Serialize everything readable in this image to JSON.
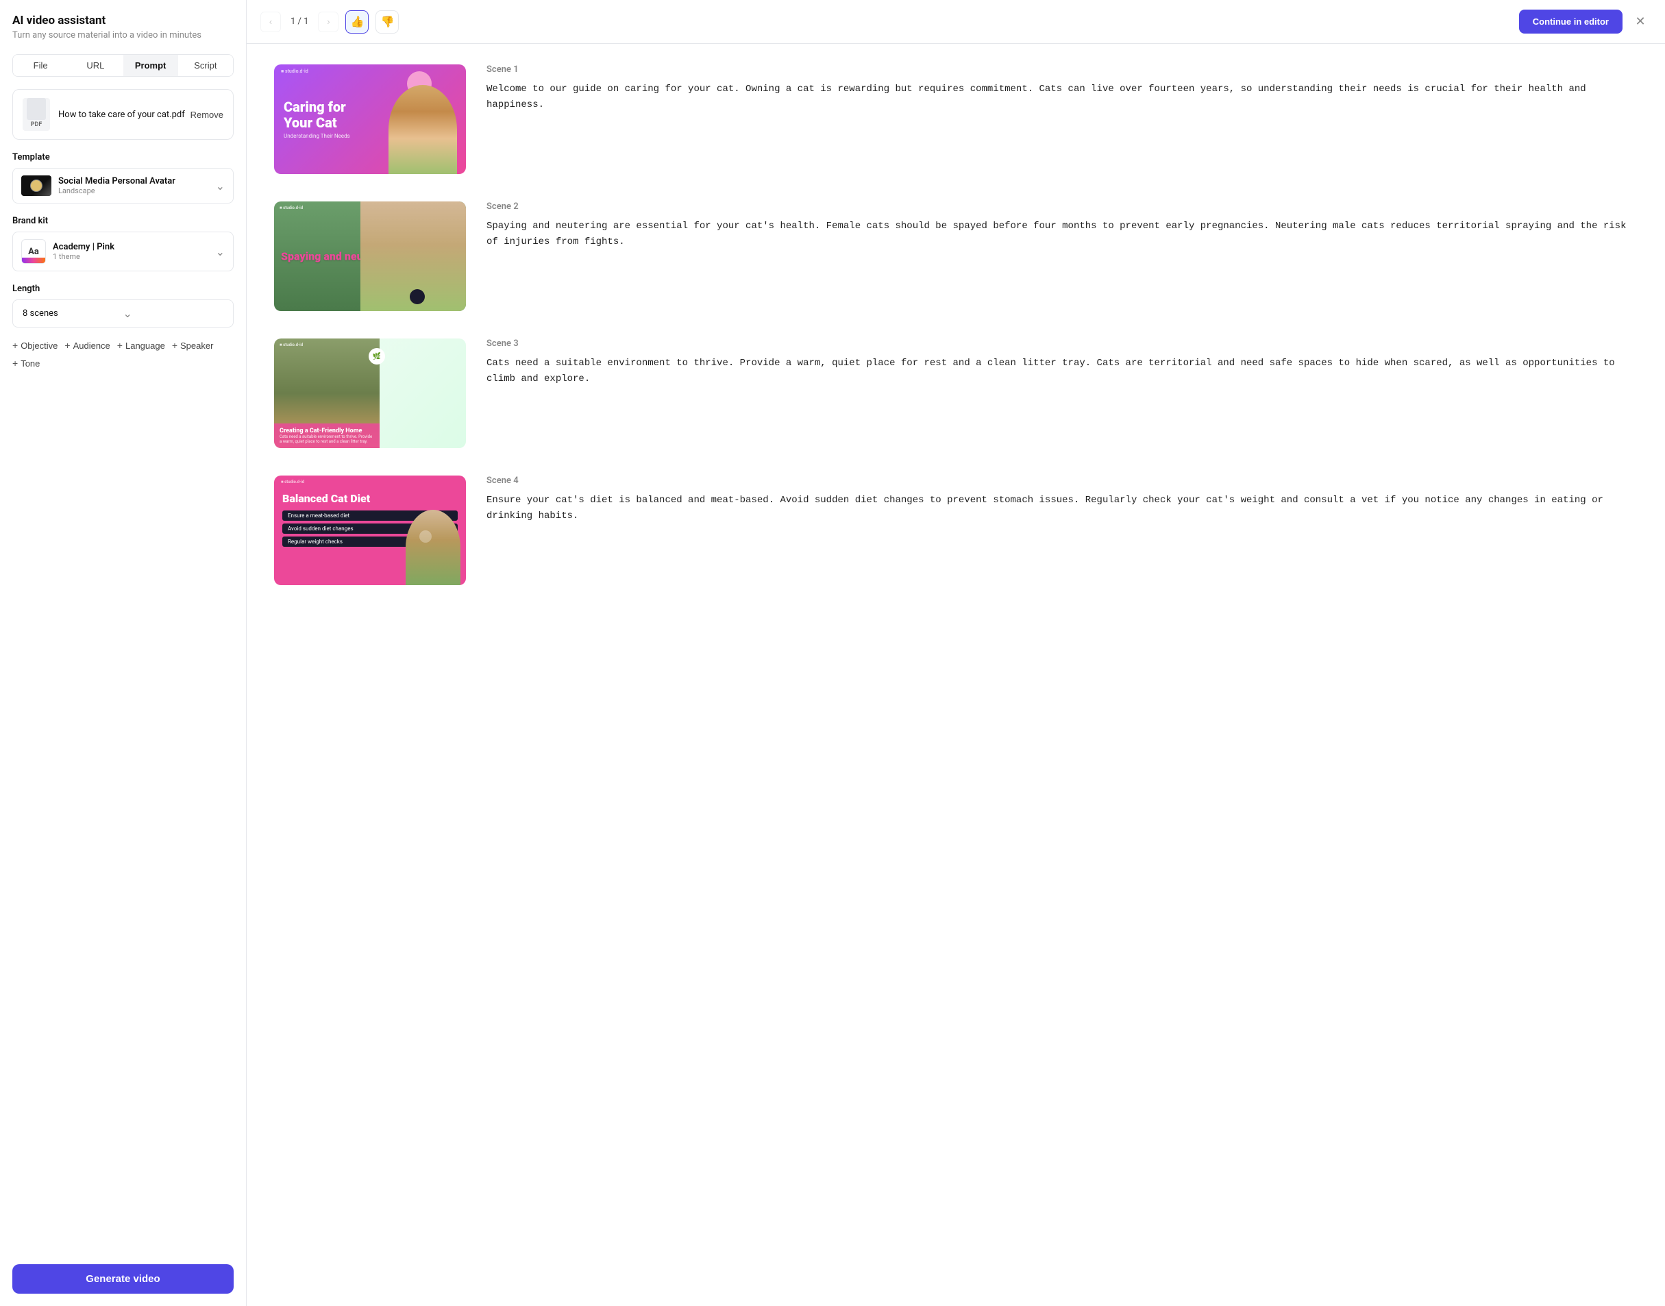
{
  "sidebar": {
    "title": "AI video assistant",
    "subtitle": "Turn any source material into a video in minutes",
    "tabs": [
      {
        "id": "file",
        "label": "File",
        "active": false
      },
      {
        "id": "url",
        "label": "URL",
        "active": false
      },
      {
        "id": "prompt",
        "label": "Prompt",
        "active": true
      },
      {
        "id": "script",
        "label": "Script",
        "active": false
      }
    ],
    "file": {
      "name": "How to take care of your cat.pdf",
      "type": "PDF",
      "remove_label": "Remove"
    },
    "template": {
      "label": "Template",
      "name": "Social Media Personal Avatar",
      "orientation": "Landscape"
    },
    "brand_kit": {
      "label": "Brand kit",
      "name": "Academy | Pink",
      "theme_count": "1 theme"
    },
    "length": {
      "label": "Length",
      "value": "8 scenes"
    },
    "extra_options": [
      {
        "id": "objective",
        "label": "Objective"
      },
      {
        "id": "audience",
        "label": "Audience"
      },
      {
        "id": "language",
        "label": "Language"
      },
      {
        "id": "speaker",
        "label": "Speaker"
      },
      {
        "id": "tone",
        "label": "Tone"
      }
    ],
    "generate_btn": "Generate video"
  },
  "topbar": {
    "page_current": "1",
    "page_total": "1",
    "continue_label": "Continue in editor",
    "prev_disabled": true,
    "next_disabled": true
  },
  "scenes": [
    {
      "id": "scene1",
      "label": "Scene 1",
      "thumb_title": "Caring for Your Cat",
      "thumb_subtitle": "Understanding Their Needs",
      "text": "Welcome to our guide on caring for your cat. Owning a cat is rewarding but requires commitment. Cats can live over fourteen years, so understanding their needs is crucial for their health and happiness."
    },
    {
      "id": "scene2",
      "label": "Scene 2",
      "thumb_title": "Spaying and neutering are essential",
      "text": "Spaying and neutering are essential for your cat's health. Female cats should be spayed before four months to prevent early pregnancies. Neutering male cats reduces territorial spraying and the risk of injuries from fights."
    },
    {
      "id": "scene3",
      "label": "Scene 3",
      "thumb_title": "Creating a Cat-Friendly Home",
      "thumb_body": "Cats need a suitable environment to thrive. Provide a warm, quiet place to rest and a clean litter tray.",
      "text": "Cats need a suitable environment to thrive. Provide a warm, quiet place for rest and a clean litter tray. Cats are territorial and need safe spaces to hide when scared, as well as opportunities to climb and explore."
    },
    {
      "id": "scene4",
      "label": "Scene 4",
      "thumb_title": "Balanced Cat Diet",
      "thumb_items": [
        "Ensure a meat-based diet",
        "Avoid sudden diet changes",
        "Regular weight checks"
      ],
      "text": "Ensure your cat's diet is balanced and meat-based. Avoid sudden diet changes to prevent stomach issues. Regularly check your cat's weight and consult a vet if you notice any changes in eating or drinking habits."
    }
  ]
}
